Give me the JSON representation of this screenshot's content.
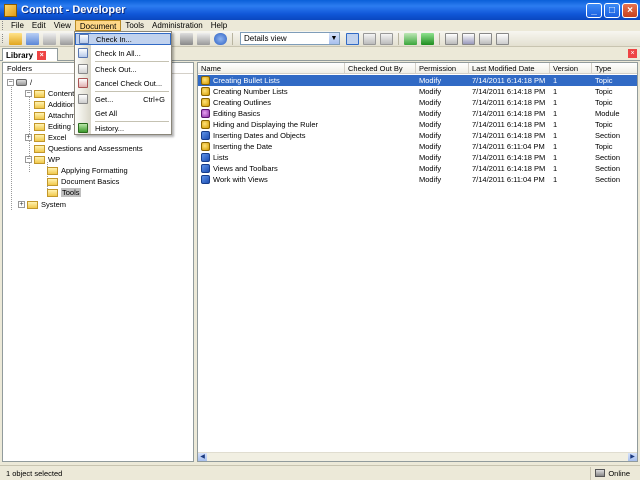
{
  "window": {
    "title": "Content - Developer"
  },
  "menu": {
    "items": [
      {
        "label": "File"
      },
      {
        "label": "Edit"
      },
      {
        "label": "View"
      },
      {
        "label": "Document"
      },
      {
        "label": "Tools"
      },
      {
        "label": "Administration"
      },
      {
        "label": "Help"
      }
    ]
  },
  "toolbar": {
    "view_select": "Details view"
  },
  "tab": {
    "label": "Library"
  },
  "document_menu": {
    "items": [
      {
        "label": "Check In...",
        "shortcut": "",
        "icon": "check-in-icon"
      },
      {
        "label": "Check In All...",
        "shortcut": "",
        "icon": "check-in-all-icon"
      },
      {
        "label": "Check Out...",
        "shortcut": "",
        "icon": "check-out-icon"
      },
      {
        "label": "Cancel Check Out...",
        "shortcut": "",
        "icon": "cancel-check-out-icon"
      },
      {
        "label": "Get...",
        "shortcut": "Ctrl+G",
        "icon": "get-icon"
      },
      {
        "label": "Get All",
        "shortcut": "",
        "icon": "get-all-icon"
      },
      {
        "label": "History...",
        "shortcut": "",
        "icon": "history-icon"
      }
    ]
  },
  "folders": {
    "header": "Folders",
    "nodes": [
      {
        "label": "/"
      },
      {
        "label": "Content"
      },
      {
        "label": "Addition"
      },
      {
        "label": "Attachm"
      },
      {
        "label": "Editing T"
      },
      {
        "label": "Excel"
      },
      {
        "label": "Questions and Assessments"
      },
      {
        "label": "WP"
      },
      {
        "label": "Applying Formatting"
      },
      {
        "label": "Document Basics"
      },
      {
        "label": "Tools"
      },
      {
        "label": "System"
      }
    ]
  },
  "list": {
    "columns": [
      "Name",
      "Checked Out By",
      "Permission",
      "Last Modified Date",
      "Version",
      "Type"
    ],
    "rows": [
      {
        "name": "Creating Bullet Lists",
        "checked_out_by": "",
        "permission": "Modify",
        "modified": "7/14/2011 6:14:18 PM",
        "version": "1",
        "type": "Topic",
        "icon": "topic"
      },
      {
        "name": "Creating Number Lists",
        "checked_out_by": "",
        "permission": "Modify",
        "modified": "7/14/2011 6:14:18 PM",
        "version": "1",
        "type": "Topic",
        "icon": "topic"
      },
      {
        "name": "Creating Outlines",
        "checked_out_by": "",
        "permission": "Modify",
        "modified": "7/14/2011 6:14:18 PM",
        "version": "1",
        "type": "Topic",
        "icon": "topic"
      },
      {
        "name": "Editing Basics",
        "checked_out_by": "",
        "permission": "Modify",
        "modified": "7/14/2011 6:14:18 PM",
        "version": "1",
        "type": "Module",
        "icon": "module"
      },
      {
        "name": "Hiding and Displaying the Ruler",
        "checked_out_by": "",
        "permission": "Modify",
        "modified": "7/14/2011 6:14:18 PM",
        "version": "1",
        "type": "Topic",
        "icon": "topic"
      },
      {
        "name": "Inserting Dates and Objects",
        "checked_out_by": "",
        "permission": "Modify",
        "modified": "7/14/2011 6:14:18 PM",
        "version": "1",
        "type": "Section",
        "icon": "section"
      },
      {
        "name": "Inserting the Date",
        "checked_out_by": "",
        "permission": "Modify",
        "modified": "7/14/2011 6:11:04 PM",
        "version": "1",
        "type": "Topic",
        "icon": "topic"
      },
      {
        "name": "Lists",
        "checked_out_by": "",
        "permission": "Modify",
        "modified": "7/14/2011 6:14:18 PM",
        "version": "1",
        "type": "Section",
        "icon": "section"
      },
      {
        "name": "Views and Toolbars",
        "checked_out_by": "",
        "permission": "Modify",
        "modified": "7/14/2011 6:14:18 PM",
        "version": "1",
        "type": "Section",
        "icon": "section"
      },
      {
        "name": "Work with Views",
        "checked_out_by": "",
        "permission": "Modify",
        "modified": "7/14/2011 6:11:04 PM",
        "version": "1",
        "type": "Section",
        "icon": "section"
      }
    ]
  },
  "status": {
    "left": "1 object selected",
    "right": "Online"
  }
}
